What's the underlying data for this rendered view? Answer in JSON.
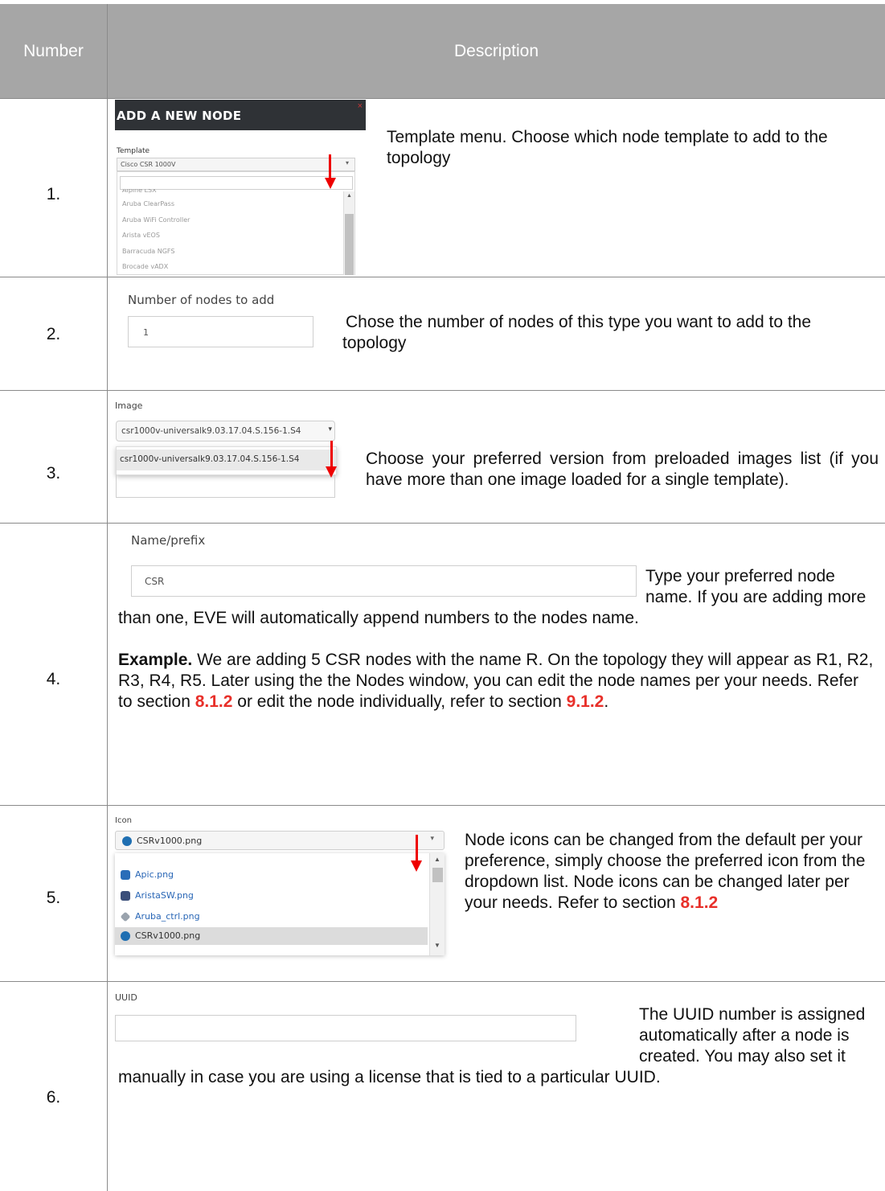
{
  "header": {
    "col_number": "Number",
    "col_description": "Description"
  },
  "rows": [
    {
      "num": "1.",
      "screenshot": {
        "title": "ADD A NEW NODE",
        "close": "×",
        "field_label": "Template",
        "selected": "Cisco CSR 1000V",
        "options": [
          "Alpine LSX",
          "Aruba ClearPass",
          "Aruba WiFi Controller",
          "Arista vEOS",
          "Barracuda NGFS",
          "Brocade vADX"
        ]
      },
      "text": "Template menu. Choose which node template to add to the topology"
    },
    {
      "num": "2.",
      "screenshot": {
        "field_label": "Number of nodes to add",
        "value": "1"
      },
      "text": "Chose the number of nodes of this type you want to add to the topology"
    },
    {
      "num": "3.",
      "screenshot": {
        "field_label": "Image",
        "selected": "csr1000v-universalk9.03.17.04.S.156-1.S4",
        "option": "csr1000v-universalk9.03.17.04.S.156-1.S4"
      },
      "text": "Choose your preferred version from preloaded images list (if you have more than one image loaded for a single template)."
    },
    {
      "num": "4.",
      "screenshot": {
        "field_label": "Name/prefix",
        "value": "CSR"
      },
      "text_a": "Type your preferred node name. If you are adding more than one, EVE will automatically append numbers to the nodes name.",
      "example_bold": "Example.",
      "example_1": "We are adding 5 CSR nodes with the name R. On the topology they will appear as R1, R2, R3, R4, R5. Later using the the Nodes window, you can edit the node names per your needs. Refer to section",
      "ref_1": "8.1.2",
      "example_2": "or edit the node individually, refer to section",
      "ref_2": "9.1.2",
      "example_end": "."
    },
    {
      "num": "5.",
      "screenshot": {
        "field_label": "Icon",
        "selected": "CSRv1000.png",
        "options": [
          "Apic.png",
          "AristaSW.png",
          "Aruba_ctrl.png",
          "CSRv1000.png"
        ]
      },
      "text": "Node icons can be changed from the default per your preference, simply choose the preferred icon from the dropdown list. Node icons can be changed later per your needs. Refer to section",
      "ref": "8.1.2"
    },
    {
      "num": "6.",
      "screenshot": {
        "field_label": "UUID",
        "value": ""
      },
      "text": "The UUID number is assigned automatically after a node is created. You may also set it manually in case you are using a license that is tied to a particular UUID."
    }
  ]
}
